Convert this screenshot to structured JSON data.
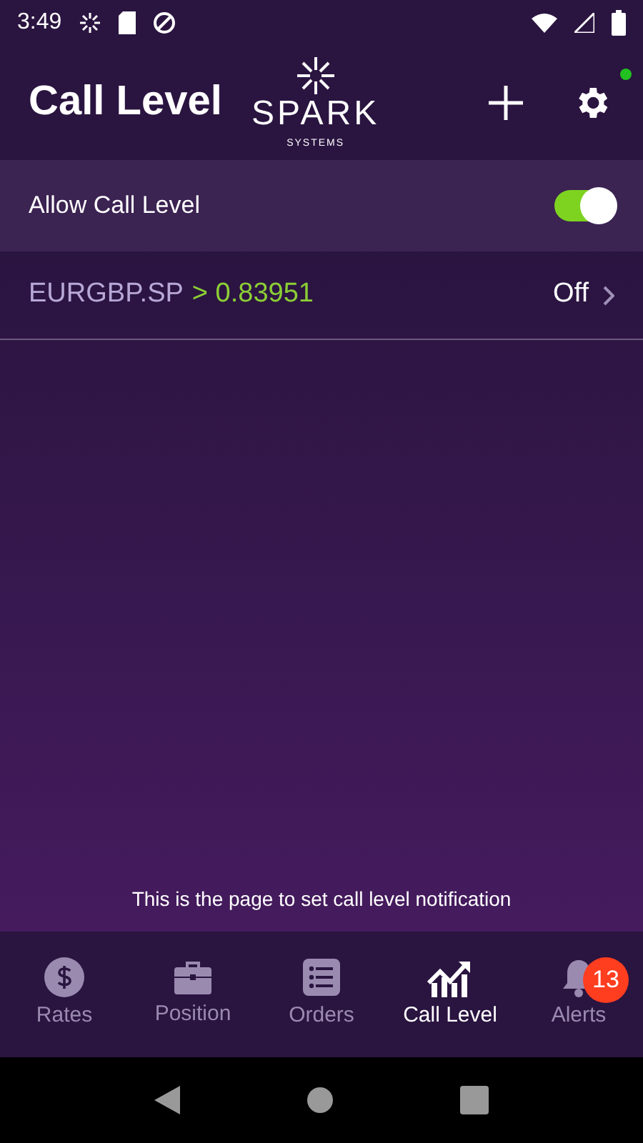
{
  "status_bar": {
    "time": "3:49"
  },
  "header": {
    "title": "Call Level",
    "logo_name": "SPARK",
    "logo_subtitle": "SYSTEMS",
    "settings_dot": true
  },
  "allow_call_level": {
    "label": "Allow Call Level",
    "on": true
  },
  "call_levels": [
    {
      "symbol": "EURGBP.SP",
      "condition": "> 0.83951",
      "status": "Off"
    }
  ],
  "note": "This is the page to set call level notification",
  "tabs": [
    {
      "label": "Rates",
      "selected": false
    },
    {
      "label": "Position",
      "selected": false
    },
    {
      "label": "Orders",
      "selected": false
    },
    {
      "label": "Call Level",
      "selected": true
    },
    {
      "label": "Alerts",
      "selected": false,
      "badge": "13"
    }
  ]
}
